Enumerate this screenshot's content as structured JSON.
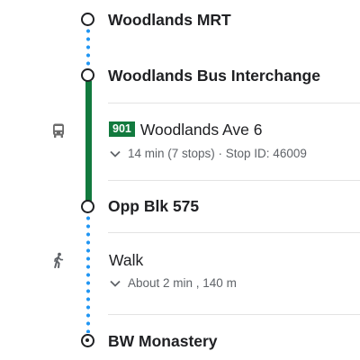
{
  "stops": [
    {
      "name": "Woodlands MRT"
    },
    {
      "name": "Woodlands Bus Interchange"
    },
    {
      "name": "Opp Blk 575"
    },
    {
      "name": "BW Monastery"
    }
  ],
  "bus_leg": {
    "route_number": "901",
    "route_color": "#127a3e",
    "destination": "Woodlands Ave 6",
    "details": "14 min (7 stops) · Stop ID: 46009",
    "icon": "bus-icon"
  },
  "walk_leg": {
    "title": "Walk",
    "details": "About 2 min , 140 m",
    "icon": "walking-icon"
  },
  "colors": {
    "walk_dots": "#2196f3",
    "bus_line": "#127a3e"
  }
}
